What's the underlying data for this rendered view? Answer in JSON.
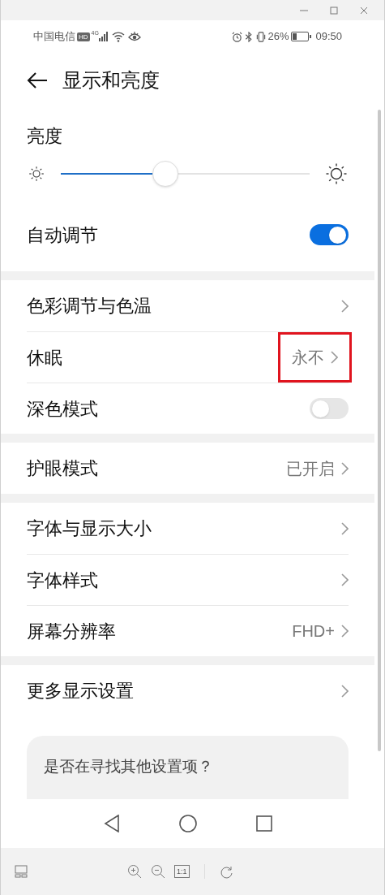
{
  "status_bar": {
    "carrier": "中国电信",
    "hd_badge": "HD",
    "network": "4G",
    "battery_text": "26%",
    "time": "09:50"
  },
  "header": {
    "title": "显示和亮度"
  },
  "brightness": {
    "label": "亮度",
    "level": 0.42
  },
  "auto_adjust": {
    "label": "自动调节",
    "on": true
  },
  "groups": [
    [
      {
        "kind": "link",
        "label": "色彩调节与色温"
      },
      {
        "kind": "link",
        "label": "休眠",
        "value": "永不",
        "highlighted": true
      },
      {
        "kind": "switch",
        "label": "深色模式",
        "on": false
      }
    ],
    [
      {
        "kind": "link",
        "label": "护眼模式",
        "value": "已开启"
      }
    ],
    [
      {
        "kind": "link",
        "label": "字体与显示大小"
      },
      {
        "kind": "link",
        "label": "字体样式"
      },
      {
        "kind": "link",
        "label": "屏幕分辨率",
        "value": "FHD+"
      }
    ],
    [
      {
        "kind": "link",
        "label": "更多显示设置"
      }
    ]
  ],
  "suggestion_card": {
    "title": "是否在寻找其他设置项？"
  },
  "toolbar": {
    "actual_size": "1:1"
  }
}
